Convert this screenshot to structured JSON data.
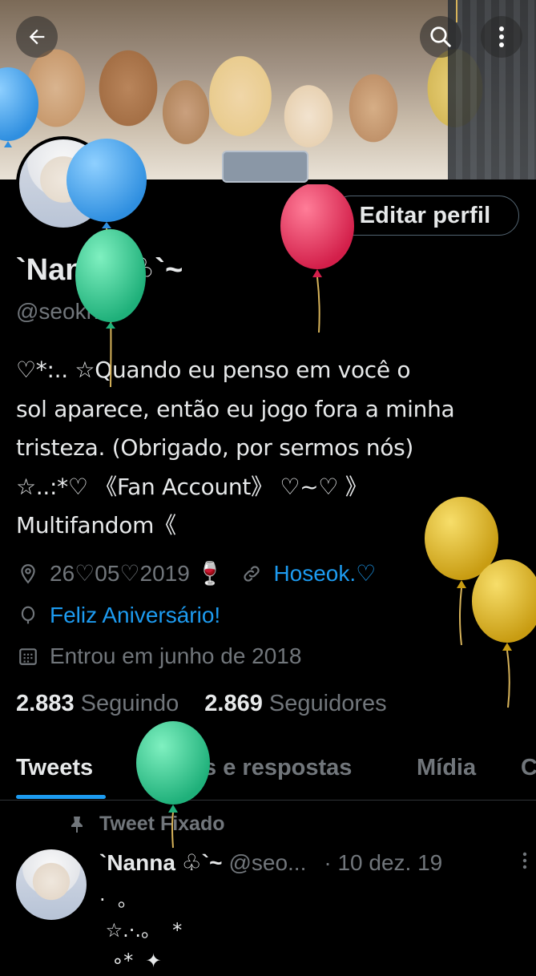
{
  "header": {
    "back_icon": "arrow-left-icon",
    "search_icon": "search-icon",
    "more_icon": "more-vertical-icon"
  },
  "profile": {
    "edit_label": "Editar perfil",
    "name": "`Nanna ♧`~",
    "handle": "@seoknan",
    "bio": "♡*:.. ☆Quando eu penso em você o\nsol aparece, então eu jogo fora a minha\ntristeza. (Obrigado, por sermos nós)\n☆..:*♡ 《Fan Account》  ♡~♡  》\nMultifandom《",
    "location": "26♡05♡2019 🍷",
    "website": "Hoseok.♡",
    "birthday": "Feliz Aniversário!",
    "joined": "Entrou em junho de 2018",
    "following_count": "2.883",
    "following_label": "Seguindo",
    "followers_count": "2.869",
    "followers_label": "Seguidores"
  },
  "tabs": [
    {
      "label": "Tweets",
      "active": true
    },
    {
      "label": "Tweets e respostas"
    },
    {
      "label": "Mídia"
    },
    {
      "label": "C"
    }
  ],
  "tweet": {
    "pinned_label": "Tweet Fixado",
    "name": "`Nanna ♧`~",
    "handle": "@seo...",
    "date": "· 10 dez. 19",
    "text": "·  。\n ☆.·.。  *\n  ∘*  ✦"
  },
  "colors": {
    "background": "#000000",
    "text": "#e7e9ea",
    "muted": "#71767b",
    "accent": "#1d9bf0",
    "border": "#536471"
  },
  "balloons": [
    "blue",
    "blue",
    "green",
    "red",
    "yellow",
    "yellow",
    "green"
  ]
}
